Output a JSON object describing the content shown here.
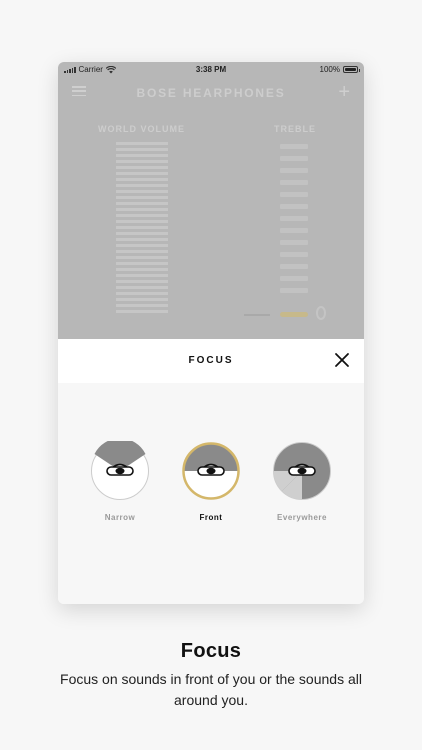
{
  "status_bar": {
    "carrier": "Carrier",
    "time": "3:38 PM",
    "battery": "100%"
  },
  "app": {
    "title": "BOSE HEARPHONES",
    "world_volume_label": "WORLD VOLUME",
    "treble_label": "TREBLE",
    "menu_icon": "hamburger-icon",
    "add_icon": "plus-icon"
  },
  "sheet": {
    "title": "FOCUS",
    "close_icon": "close-icon",
    "options": [
      {
        "label": "Narrow",
        "selected": false
      },
      {
        "label": "Front",
        "selected": true
      },
      {
        "label": "Everywhere",
        "selected": false
      }
    ]
  },
  "caption": {
    "title": "Focus",
    "text": "Focus on sounds in front of you or the sounds all around you."
  },
  "colors": {
    "accent_ring": "#d4b76a",
    "wedge": "#8a8a8a",
    "app_overlay": "#b7b7b7"
  }
}
